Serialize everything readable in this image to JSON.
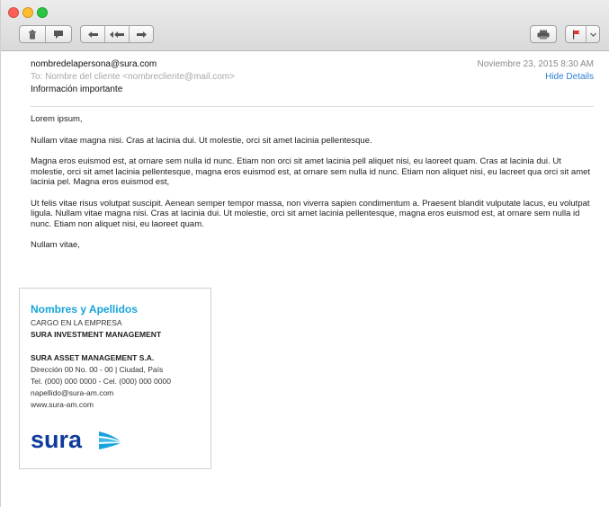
{
  "email": {
    "from": "nombredelapersona@sura.com",
    "to": "To: Nombre del cliente <nombrecliente@mail.com>",
    "subject": "Información importante",
    "date": "Noviembre 23, 2015 8:30 AM",
    "hide_details": "Hide Details"
  },
  "body": {
    "greeting": "Lorem ipsum,",
    "p1": "Nullam vitae magna nisi. Cras at lacinia dui. Ut molestie, orci sit amet lacinia pellentesque.",
    "p2": "Magna eros euismod est, at ornare sem nulla id nunc. Etiam non orci sit amet lacinia pell aliquet nisi, eu laoreet quam. Cras at lacinia dui. Ut molestie, orci sit amet lacinia pellentesque, magna eros euismod est, at ornare sem nulla id nunc. Etiam non aliquet nisi, eu lacreet qua orci sit amet lacinia pel. Magna eros euismod est,",
    "p3": "Ut felis vitae risus volutpat suscipit. Aenean semper tempor massa, non viverra sapien condimentum a. Praesent blandit vulputate lacus, eu volutpat ligula. Nullam vitae magna nisi. Cras at lacinia dui. Ut molestie, orci sit amet lacinia pellentesque, magna eros euismod est, at ornare sem nulla id nunc. Etiam non aliquet nisi, eu laoreet quam.",
    "closing": "Nullam vitae,"
  },
  "signature": {
    "name": "Nombres y Apellidos",
    "position": "CARGO EN LA EMPRESA",
    "company_unit": "SURA INVESTMENT MANAGEMENT",
    "company": "SURA ASSET MANAGEMENT S.A.",
    "address": "Dirección 00 No. 00 - 00 | Ciudad, País",
    "phone": "Tel. (000) 000 0000 - Cel. (000) 000 0000",
    "email": "napellido@sura-am.com",
    "web": "www.sura-am.com",
    "logo": "sura"
  },
  "toolbar": {
    "icons": [
      "trash-icon",
      "junk-icon",
      "reply-icon",
      "reply-all-icon",
      "forward-icon",
      "print-icon",
      "flag-icon",
      "chevron-down-icon"
    ]
  },
  "colors": {
    "accent": "#17a4d9",
    "brand": "#0f3c9b",
    "link": "#2f7fd6"
  }
}
